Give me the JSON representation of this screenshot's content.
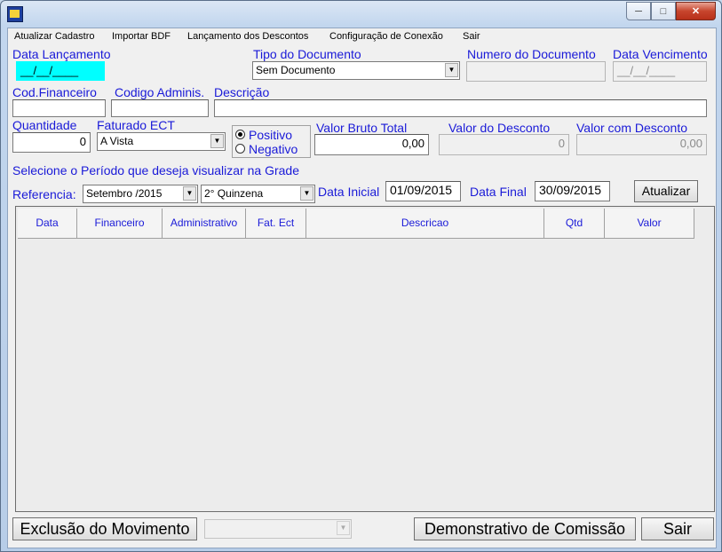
{
  "menu": [
    "Atualizar Cadastro",
    "Importar BDF",
    "Lançamento dos Descontos",
    "Configuração de Conexão",
    "Sair"
  ],
  "labels": {
    "data_lancamento": "Data Lançamento",
    "tipo_documento": "Tipo do Documento",
    "numero_documento": "Numero do Documento",
    "data_vencimento": "Data Vencimento",
    "cod_financeiro": "Cod.Financeiro",
    "codigo_adminis": "Codigo Adminis.",
    "descricao": "Descrição",
    "quantidade": "Quantidade",
    "faturado_ect": "Faturado ECT",
    "valor_bruto": "Valor Bruto Total",
    "valor_desconto": "Valor do Desconto",
    "valor_com_desconto": "Valor com Desconto",
    "periodo": "Selecione o Período que deseja visualizar na Grade",
    "referencia": "Referencia:",
    "data_inicial": "Data Inicial",
    "data_final": "Data Final"
  },
  "fields": {
    "data_lancamento": "__/__/____",
    "tipo_documento": "Sem Documento",
    "numero_documento": "",
    "data_vencimento": "__/__/____",
    "cod_financeiro": "",
    "codigo_adminis": "",
    "descricao": "",
    "quantidade": "0",
    "faturado_ect": "A Vista",
    "valor_bruto": "0,00",
    "valor_desconto": "0",
    "valor_com_desconto": "0,00",
    "referencia_mes": "Setembro /2015",
    "referencia_quinzena": "2° Quinzena",
    "data_inicial": "01/09/2015",
    "data_final": "30/09/2015"
  },
  "radio": {
    "positivo": "Positivo",
    "negativo": "Negativo",
    "selected": "positivo"
  },
  "buttons": {
    "atualizar": "Atualizar",
    "exclusao": "Exclusão do Movimento",
    "demonstrativo": "Demonstrativo de Comissão",
    "sair": "Sair"
  },
  "grid_columns": [
    "Data",
    "Financeiro",
    "Administrativo",
    "Fat. Ect",
    "Descricao",
    "Qtd",
    "Valor"
  ],
  "bottom_combo": "",
  "colors": {
    "label": "#1a1ad8",
    "focus_field": "#00ffff"
  }
}
